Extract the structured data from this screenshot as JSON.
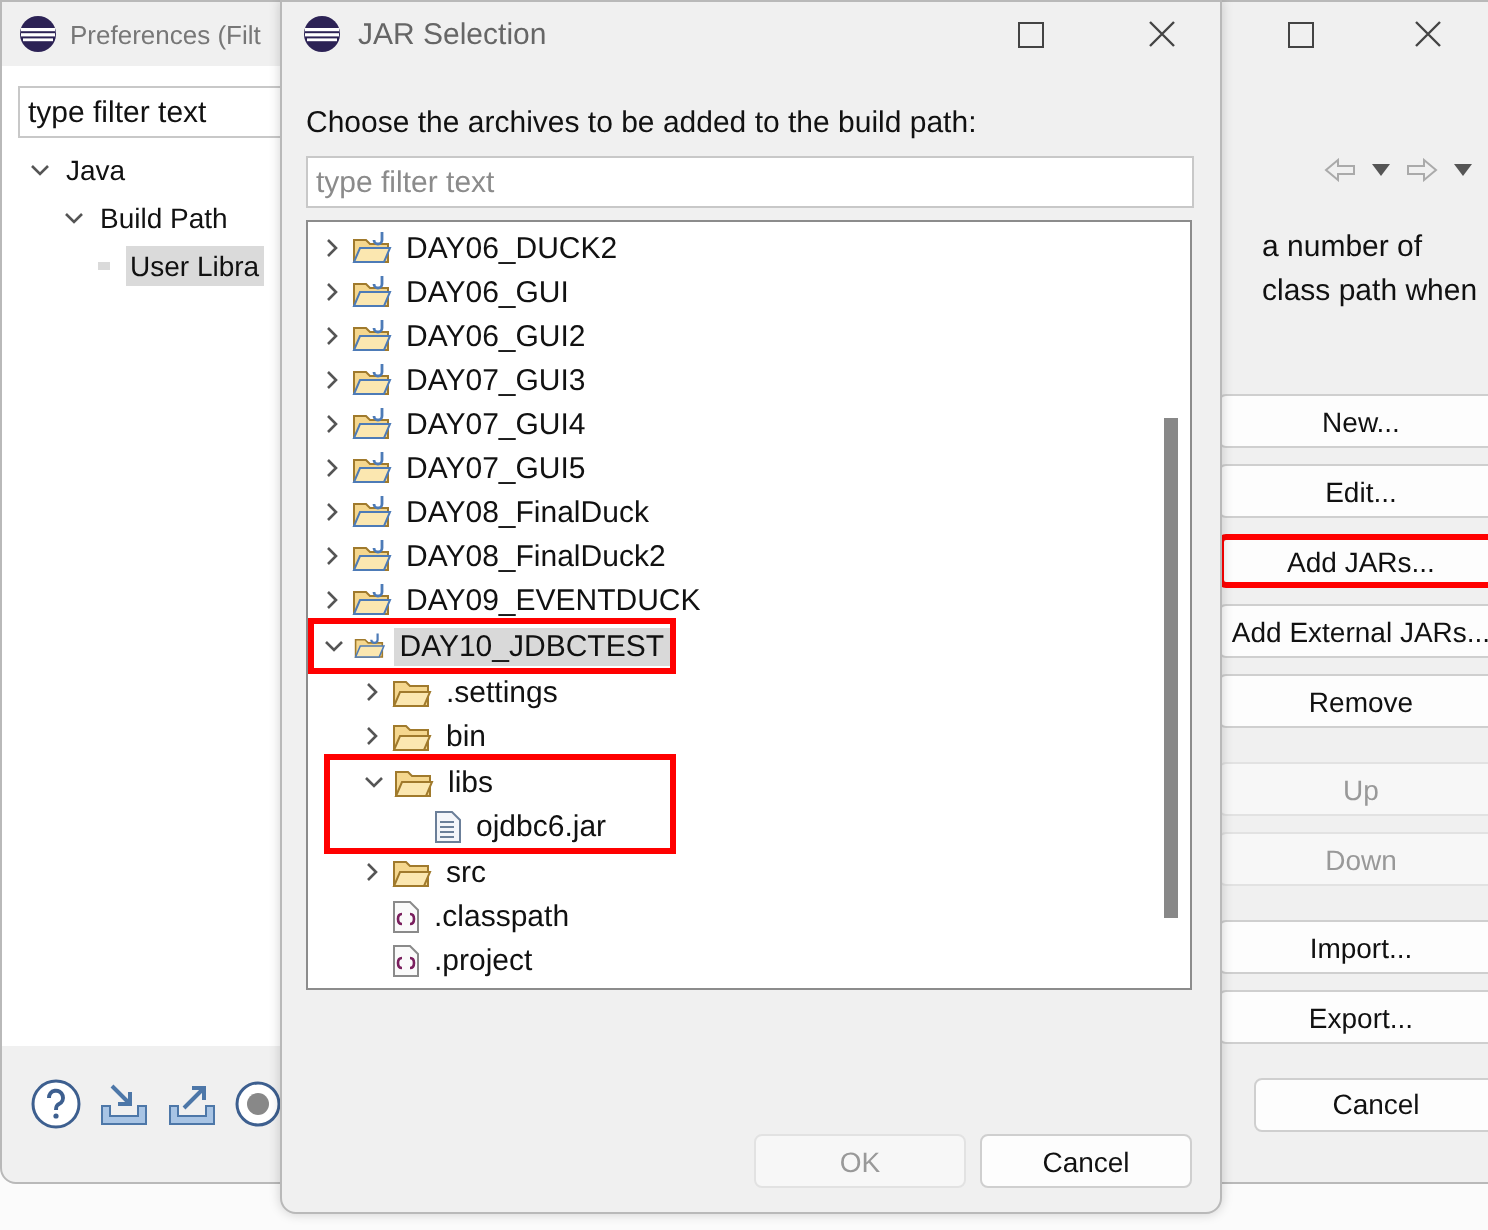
{
  "background_window": {
    "title": "Preferences (Filt",
    "filter": {
      "value": "type filter text"
    },
    "tree": [
      {
        "label": "Java",
        "expanded": true,
        "selected": false,
        "children": [
          {
            "label": "Build Path",
            "expanded": true,
            "selected": false,
            "children": [
              {
                "label": "User Libra",
                "selected": true
              }
            ]
          }
        ]
      }
    ],
    "description": [
      "a number of",
      "class path when"
    ],
    "button_groups": [
      [
        {
          "label": "New...",
          "disabled": false,
          "highlighted": false
        },
        {
          "label": "Edit...",
          "disabled": false,
          "highlighted": false
        },
        {
          "label": "Add JARs...",
          "disabled": false,
          "highlighted": true
        },
        {
          "label": "Add External JARs...",
          "disabled": false,
          "highlighted": false
        },
        {
          "label": "Remove",
          "disabled": false,
          "highlighted": false
        }
      ],
      [
        {
          "label": "Up",
          "disabled": true,
          "highlighted": false
        },
        {
          "label": "Down",
          "disabled": true,
          "highlighted": false
        }
      ],
      [
        {
          "label": "Import...",
          "disabled": false,
          "highlighted": false
        },
        {
          "label": "Export...",
          "disabled": false,
          "highlighted": false
        }
      ]
    ],
    "cancel": {
      "label": "Cancel"
    }
  },
  "dialog": {
    "title": "JAR Selection",
    "message": "Choose the archives to be added to the build path:",
    "filter": {
      "placeholder": "type filter text"
    },
    "tree": [
      {
        "kind": "project",
        "label": "DAY06_DUCK2",
        "expanded": false,
        "selected": false,
        "highlighted": false
      },
      {
        "kind": "project",
        "label": "DAY06_GUI",
        "expanded": false,
        "selected": false,
        "highlighted": false
      },
      {
        "kind": "project",
        "label": "DAY06_GUI2",
        "expanded": false,
        "selected": false,
        "highlighted": false
      },
      {
        "kind": "project",
        "label": "DAY07_GUI3",
        "expanded": false,
        "selected": false,
        "highlighted": false
      },
      {
        "kind": "project",
        "label": "DAY07_GUI4",
        "expanded": false,
        "selected": false,
        "highlighted": false
      },
      {
        "kind": "project",
        "label": "DAY07_GUI5",
        "expanded": false,
        "selected": false,
        "highlighted": false
      },
      {
        "kind": "project",
        "label": "DAY08_FinalDuck",
        "expanded": false,
        "selected": false,
        "highlighted": false
      },
      {
        "kind": "project",
        "label": "DAY08_FinalDuck2",
        "expanded": false,
        "selected": false,
        "highlighted": false
      },
      {
        "kind": "project",
        "label": "DAY09_EVENTDUCK",
        "expanded": false,
        "selected": false,
        "highlighted": false
      },
      {
        "kind": "project",
        "label": "DAY10_JDBCTEST",
        "expanded": true,
        "selected": true,
        "highlighted": true,
        "children": [
          {
            "kind": "folder",
            "label": ".settings",
            "expanded": false,
            "selected": false,
            "highlighted": false
          },
          {
            "kind": "folder",
            "label": "bin",
            "expanded": false,
            "selected": false,
            "highlighted": false
          },
          {
            "kind": "folder",
            "label": "libs",
            "expanded": true,
            "selected": false,
            "highlighted": true,
            "children": [
              {
                "kind": "jar",
                "label": "ojdbc6.jar",
                "selected": false,
                "highlighted": true
              }
            ]
          },
          {
            "kind": "folder",
            "label": "src",
            "expanded": false,
            "selected": false,
            "highlighted": false
          },
          {
            "kind": "file",
            "label": ".classpath",
            "selected": false,
            "highlighted": false
          },
          {
            "kind": "file",
            "label": ".project",
            "selected": false,
            "highlighted": false
          }
        ]
      }
    ],
    "ok": {
      "label": "OK",
      "disabled": true
    },
    "cancel": {
      "label": "Cancel",
      "disabled": false
    }
  }
}
